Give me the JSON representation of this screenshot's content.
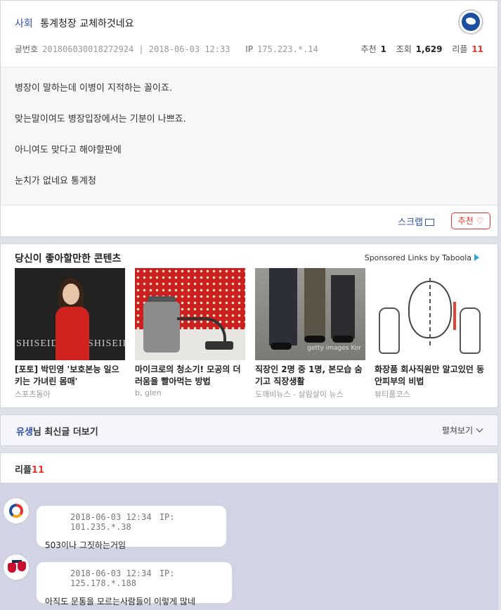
{
  "post": {
    "category": "사회",
    "title": "통계청장 교체하것네요",
    "post_no_label": "글번호",
    "post_no": "20180603001827292 4",
    "post_no_full": "201806030018272924",
    "datetime": "2018-06-03 12:33",
    "ip_label": "IP",
    "ip": "175.223.*.14",
    "recommend_label": "추천",
    "recommend_count": "1",
    "views_label": "조회",
    "views_count": "1,629",
    "reply_label": "리플",
    "reply_count": "11",
    "body": [
      "병장이 말하는데 이병이 지적하는 꼴이죠.",
      "맞는말이여도 병장입장에서는 기분이 나쁘죠.",
      "아니여도 맞다고 해야할판에",
      "눈치가 없네요 통계청"
    ],
    "scrap_label": "스크랩",
    "recommend_button": "추천 ♡"
  },
  "recommended": {
    "title": "당신이 좋아할만한 콘텐츠",
    "sponsor": "Sponsored Links by Taboola",
    "cards": [
      {
        "title": "[포토] 박민영 '보호본능 일으키는 가녀린 몸매'",
        "source": "스포츠동아",
        "brand": "SHISEIDO"
      },
      {
        "title": "마이크로의 청소기! 모공의 더러움을 빨아먹는 방법",
        "source": "b, glen"
      },
      {
        "title": "직장인 2명 중 1명, 본모습 숨기고 직장생활",
        "source": "도깨비뉴스 - 살림살이 뉴스",
        "watermark": "getty images Kor"
      },
      {
        "title": "화장품 회사직원만 알고있던 동안피부의 비법",
        "source": "뷰티풀코스"
      }
    ]
  },
  "more": {
    "nickname": "유생",
    "label": "님 최신글 더보기",
    "expand": "펼쳐보기"
  },
  "replies_section": {
    "label": "리플",
    "count": "11"
  },
  "replies": [
    {
      "datetime": "2018-06-03 12:34",
      "ip": "IP: 101.235.*.38",
      "text": "503이나 그짓하는거임"
    },
    {
      "datetime": "2018-06-03 12:34",
      "ip": "IP: 125.178.*.188",
      "text": "아직도 문통을 모르는사람들이 이렇게 많네"
    }
  ],
  "colors": {
    "accent_blue": "#2e50a8",
    "accent_red": "#e8332c",
    "reply_bg": "#d2d4e6"
  }
}
